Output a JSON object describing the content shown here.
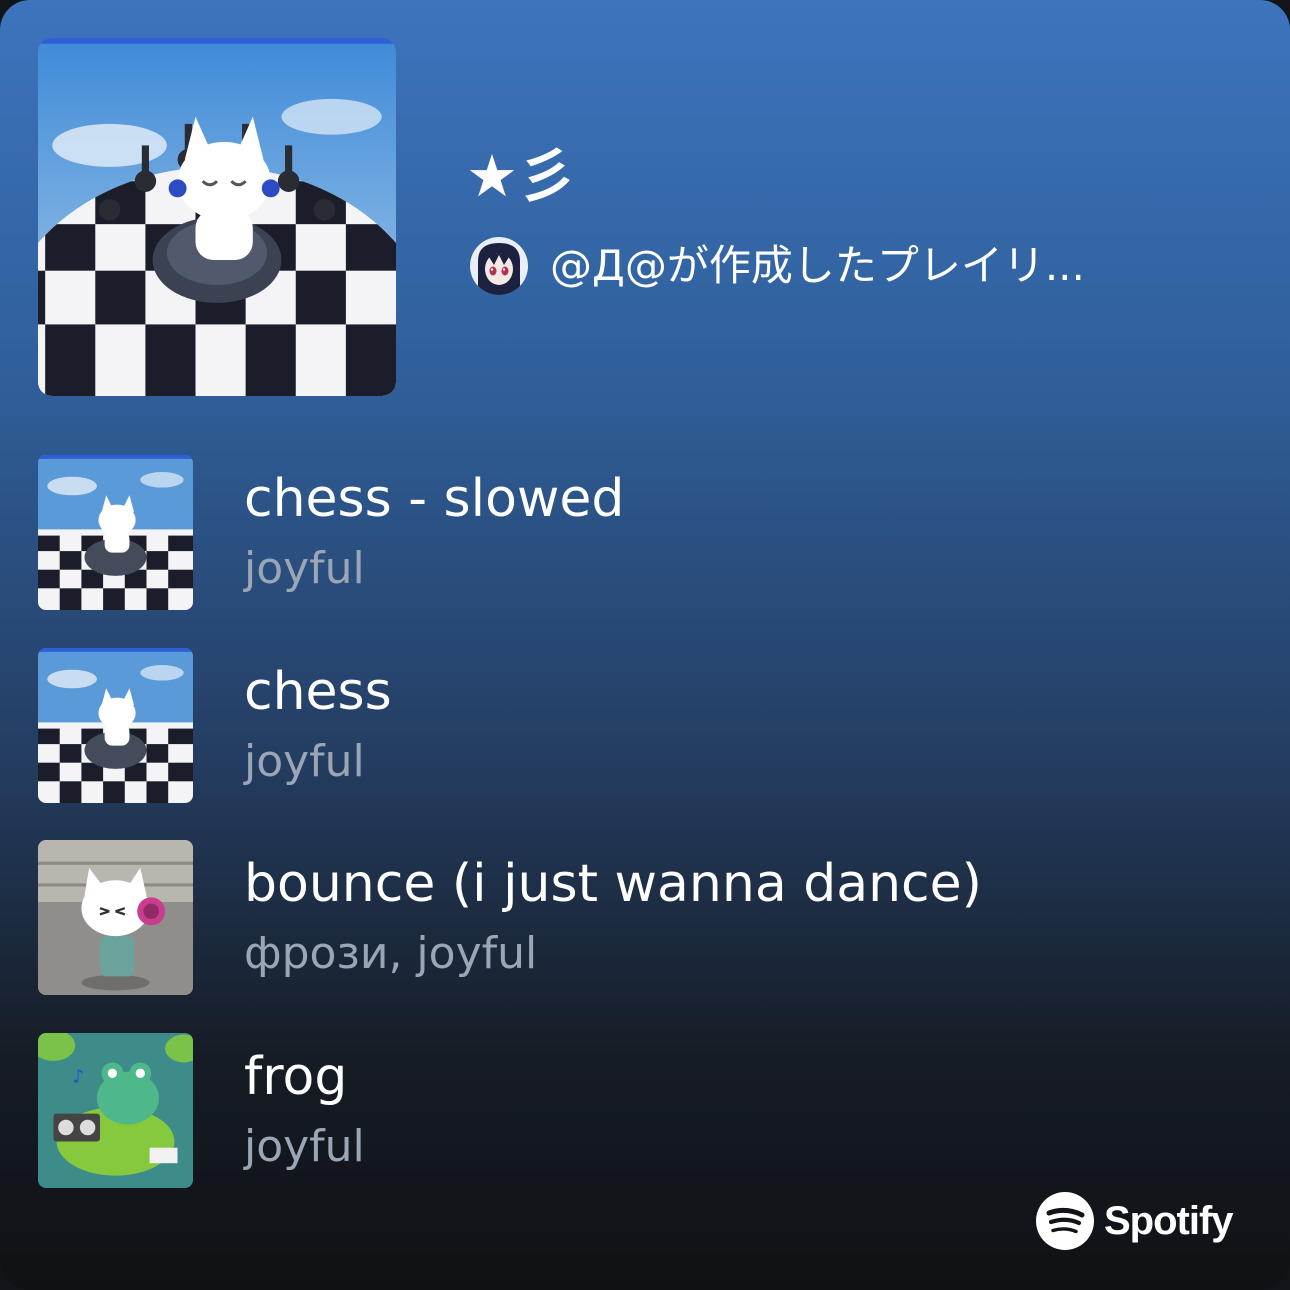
{
  "playlist": {
    "title": "★彡",
    "creator_line": "@Д@が作成したプレイリ..."
  },
  "tracks": [
    {
      "title": "chess - slowed",
      "artist": "joyful",
      "art": "chess-cat-art"
    },
    {
      "title": "chess",
      "artist": "joyful",
      "art": "chess-cat-art"
    },
    {
      "title": "bounce (i just wanna dance)",
      "artist": "фрози, joyful",
      "art": "headphone-cat-art"
    },
    {
      "title": "frog",
      "artist": "joyful",
      "art": "frog-boombox-art"
    }
  ],
  "brand": {
    "name": "Spotify",
    "logo": "spotify-logo-icon"
  },
  "colors": {
    "gradient_top": "#3d74bd",
    "gradient_bottom": "#0f1114",
    "title_text": "#ffffff",
    "subtitle_text": "#9aa6b6"
  }
}
